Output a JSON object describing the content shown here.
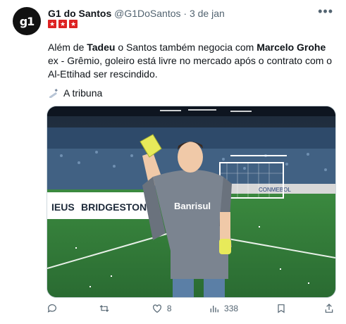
{
  "tweet": {
    "avatar_text": "g1",
    "author_name": "G1 do Santos",
    "author_handle": "@G1DoSantos",
    "separator": "·",
    "date": "3 de jan",
    "badges": [
      "★",
      "★",
      "★"
    ],
    "text_parts": {
      "p1": "Além de ",
      "b1": "Tadeu",
      "p2": " o Santos também negocia com ",
      "b2": "Marcelo Grohe",
      "p3": " ex - Grêmio, goleiro está livre no mercado após o contrato com o Al-Ettihad ser rescindido."
    },
    "source_label": "A tribuna",
    "media": {
      "ad_board_left": "IEUS",
      "ad_board_brand": "BRIDGESTONE",
      "ad_board_right": "CONMEBOL",
      "jersey_sponsor": "Banrisul"
    }
  },
  "actions": {
    "reply_count": "",
    "retweet_count": "",
    "like_count": "8",
    "view_count": "338"
  },
  "colors": {
    "secondary_text": "#536471",
    "badge_red": "#dd2222",
    "pitch_green": "#2f7d3a"
  }
}
